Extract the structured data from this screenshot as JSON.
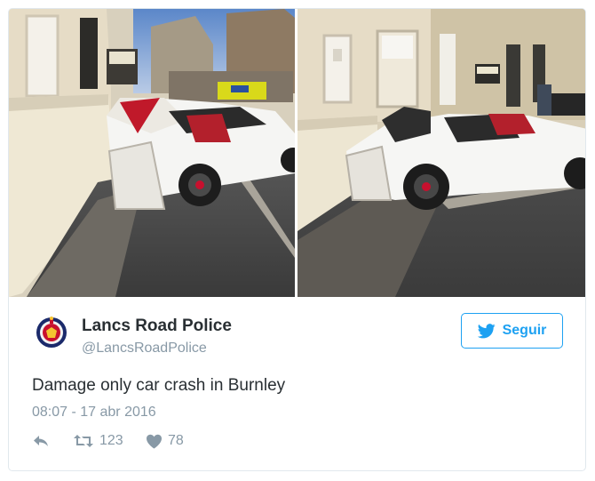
{
  "tweet": {
    "author_name": "Lancs Road Police",
    "author_handle": "@LancsRoadPolice",
    "follow_label": "Seguir",
    "text": "Damage only car crash in Burnley",
    "timestamp": "08:07 - 17 abr 2016",
    "retweet_count": "123",
    "like_count": "78"
  },
  "colors": {
    "accent": "#1da1f2",
    "muted": "#8899a6",
    "text": "#292f33",
    "border": "#e1e8ed"
  },
  "icons": {
    "follow": "twitter-bird-icon",
    "reply": "reply-icon",
    "retweet": "retweet-icon",
    "like": "heart-icon",
    "avatar": "police-badge-icon"
  }
}
